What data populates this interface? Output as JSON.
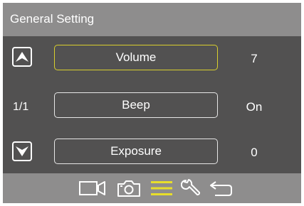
{
  "header": {
    "title": "General Setting"
  },
  "page_indicator": "1/1",
  "settings": [
    {
      "label": "Volume",
      "value": "7",
      "selected": true
    },
    {
      "label": "Beep",
      "value": "On",
      "selected": false
    },
    {
      "label": "Exposure",
      "value": "0",
      "selected": false
    }
  ],
  "nav": {
    "up_icon": "arrow-up-icon",
    "down_icon": "arrow-down-icon"
  },
  "tabs": [
    {
      "icon": "video-camera-icon",
      "active": false
    },
    {
      "icon": "photo-camera-icon",
      "active": false
    },
    {
      "icon": "menu-icon",
      "active": true
    },
    {
      "icon": "wrench-icon",
      "active": false
    },
    {
      "icon": "back-icon",
      "active": false
    }
  ],
  "colors": {
    "background": "#525151",
    "bar": "#8e8d8d",
    "accent": "#d9cf2e",
    "text": "#ffffff"
  }
}
